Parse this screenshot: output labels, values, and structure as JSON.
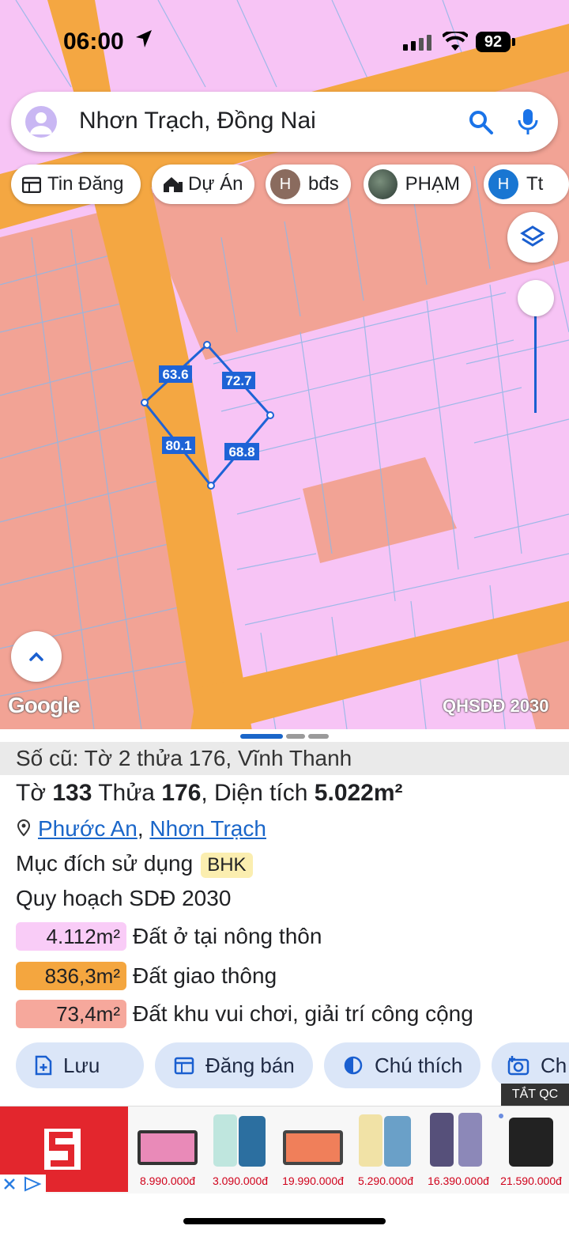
{
  "status_bar": {
    "time": "06:00",
    "battery": "92"
  },
  "search": {
    "query": "Nhơn Trạch, Đồng Nai"
  },
  "chips": [
    {
      "label": "Tin Đăng",
      "icon": "calendar-icon"
    },
    {
      "label": "Dự Án",
      "icon": "house-icon"
    },
    {
      "label": "bđs",
      "avatar_letter": "H"
    },
    {
      "label": "PHẠM",
      "avatar": "photo"
    },
    {
      "label": "Tt",
      "avatar_letter": "H"
    }
  ],
  "map": {
    "edge_labels": [
      "63.6",
      "72.7",
      "80.1",
      "68.8"
    ],
    "google_logo": "Google",
    "plan_label": "QHSDĐ 2030",
    "colors": {
      "residential": "#f7c4f5",
      "recreation": "#f2a395",
      "road": "#f4a742",
      "outline": "#1e63d6"
    }
  },
  "sheet": {
    "old_number": "Số cũ: Tờ 2 thửa 176, Vĩnh Thanh",
    "title": {
      "sheet_label": "Tờ",
      "sheet_no": "133",
      "parcel_label": "Thửa",
      "parcel_no": "176",
      "area_label": ", Diện tích",
      "area": "5.022m²"
    },
    "location": {
      "ward": "Phước An",
      "sep": ", ",
      "district": "Nhơn Trạch"
    },
    "purpose_label": "Mục đích sử dụng",
    "purpose_code": "BHK",
    "plan_title": "Quy hoạch SDĐ 2030",
    "land_uses": [
      {
        "area": "4.112m²",
        "label": "Đất ở tại nông thôn",
        "color": "#f9ccf7"
      },
      {
        "area": "836,3m²",
        "label": "Đất giao thông",
        "color": "#f4a63f"
      },
      {
        "area": "73,4m²",
        "label": "Đất khu vui chơi, giải trí công cộng",
        "color": "#f6a89c"
      }
    ],
    "actions": {
      "save": "Lưu",
      "post": "Đăng bán",
      "legend": "Chú thích",
      "photo": "Ch"
    }
  },
  "ad": {
    "close_label": "TẮT QC",
    "prices": [
      "8.990.000đ",
      "3.090.000đ",
      "19.990.000đ",
      "5.290.000đ",
      "16.390.000đ",
      "21.590.000đ"
    ]
  }
}
